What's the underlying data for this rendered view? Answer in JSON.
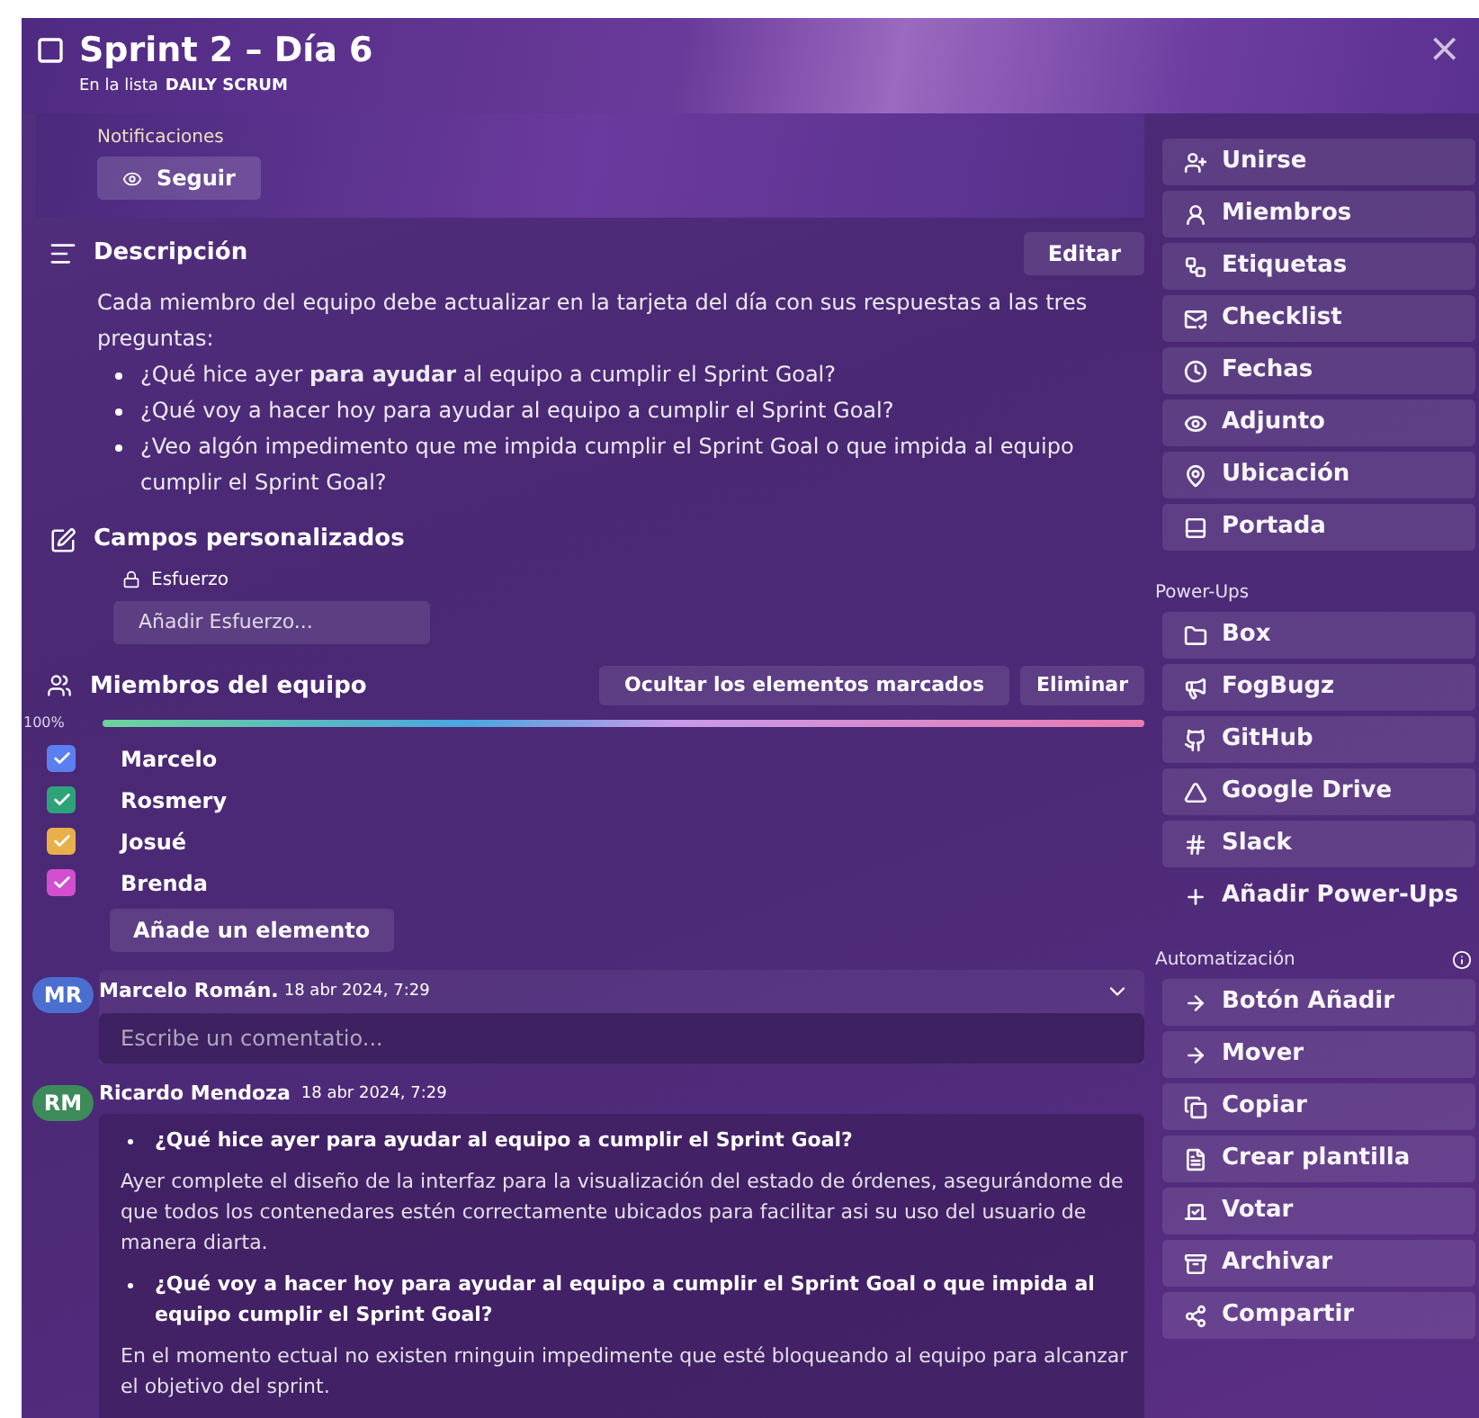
{
  "card": {
    "title": "Sprint 2 – Día 6",
    "list_prefix": "En la lista",
    "list_name": "DAILY SCRUM",
    "close": "×"
  },
  "notifications": {
    "label": "Notificaciones",
    "button": "Seguir"
  },
  "description": {
    "title": "Descripción",
    "edit": "Editar",
    "intro": "Cada miembro del equipo debe actualizar en la tarjeta del día con sus respuestas a las tres preguntas:",
    "bullets": [
      "¿Qué hice ayer **para ayudar** al equipo a cumplir el Sprint Goal?",
      "¿Qué voy a hacer hoy para ayudar al equipo a cumplir el Sprint Goal?",
      "¿Veo algón impedimento que me impida cumplir el Sprint Goal o que impida al equipo cumplir el Sprint Goal?"
    ]
  },
  "custom_fields": {
    "title": "Campos personalizados",
    "field_label": "Esfuerzo",
    "field_button": "Añadir Esfuerzo..."
  },
  "checklist": {
    "title": "Miembros del equipo",
    "hide_button": "Ocultar los elementos marcados",
    "delete_button": "Eliminar",
    "percent": "100%",
    "level": 1,
    "add_button": "Añade un elemento",
    "items": [
      {
        "label": "Marcelo",
        "checked": true,
        "color": "#5b7ff0"
      },
      {
        "label": "Rosmery",
        "checked": true,
        "color": "#2ea37a"
      },
      {
        "label": "Josué",
        "checked": true,
        "color": "#e8b04a"
      },
      {
        "label": "Brenda",
        "checked": true,
        "color": "#d24fd0"
      }
    ]
  },
  "comment_box": {
    "initials": "MR",
    "author": "Marcelo Román.",
    "time": "18 abr 2024, 7:29",
    "placeholder": "Escribe un comentatio..."
  },
  "comments": [
    {
      "initials": "RM",
      "author": "Ricardo Mendoza",
      "time": "18 abr 2024, 7:29",
      "blocks": [
        {
          "kind": "question",
          "text": "¿Qué hice ayer para ayudar al equipo a cumplir el Sprint Goal?"
        },
        {
          "kind": "paragraph",
          "text": "Ayer complete el diseño de la interfaz para la visualización del estado de órdenes, asegurándome de que todos los contenedares estén correctamente ubicados para facilitar asi su uso del usuario de manera diarta."
        },
        {
          "kind": "question",
          "text": "¿Qué voy a hacer hoy para ayudar al equipo a cumplir el Sprint Goal o que impida al equipo cumplir el Sprint Goal?"
        },
        {
          "kind": "paragraph",
          "text": "En el momento ectual no existen rninguin impedimente que esté bloqueando al equipo para alcanzar el objetivo del sprint."
        }
      ]
    }
  ],
  "sidebar": {
    "actions": [
      "Unirse",
      "Miembros",
      "Etiquetas",
      "Checklist",
      "Fechas",
      "Adjunto",
      "Ubicación",
      "Portada"
    ],
    "powerups_title": "Power-Ups",
    "powerups": [
      {
        "label": "Box",
        "kind": "tile"
      },
      {
        "label": "FogBugz",
        "kind": "tile"
      },
      {
        "label": "GitHub",
        "kind": "tile"
      },
      {
        "label": "Google Drive",
        "kind": "tile"
      },
      {
        "label": "Slack",
        "kind": "tile"
      },
      {
        "label": "Añadir Power-Ups",
        "kind": "add"
      }
    ],
    "automation_title": "Automatización",
    "automation": [
      "Botón Añadir",
      "Mover",
      "Copiar",
      "Crear plantilla",
      "Votar",
      "Archivar",
      "Compartir"
    ]
  }
}
